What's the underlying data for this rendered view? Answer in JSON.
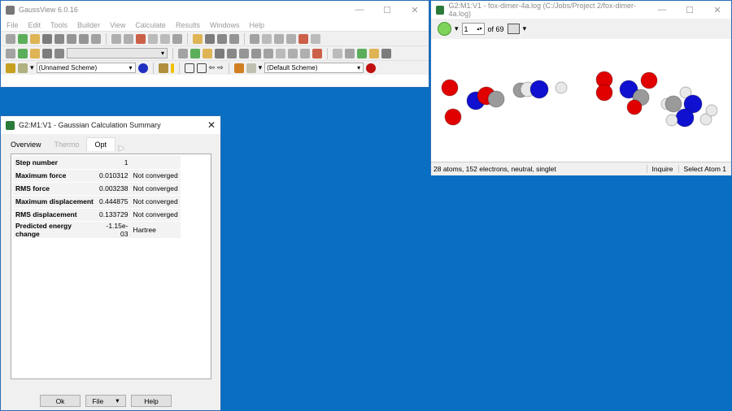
{
  "main_window": {
    "title": "GaussView 6.0.16",
    "menu": [
      "File",
      "Edit",
      "Tools",
      "Builder",
      "View",
      "Calculate",
      "Results",
      "Windows",
      "Help"
    ],
    "toolbar1": [
      "new-icon",
      "add-icon",
      "open-icon",
      "save-icon",
      "print-icon",
      "camera-icon",
      "save-image-icon",
      "list-icon",
      "|",
      "cut-icon",
      "copy-icon",
      "paste-icon",
      "delete-icon",
      "undo-icon",
      "redo-icon",
      "|",
      "symmetry-icon",
      "clean-icon",
      "bond-icon",
      "fragment-icon",
      "|",
      "text-a-icon",
      "r-group-icon",
      "link-icon",
      "layers-icon",
      "diamond-icon",
      "atom-pin-icon"
    ],
    "toolbar2": [
      "builder-a-icon",
      "ring-icon",
      "chain-icon",
      "dots-icon",
      "fragment-b-icon"
    ],
    "toolbar2b": [
      "bond-length-icon",
      "angle-icon",
      "dihedral-icon",
      "inquire-icon",
      "invert-icon",
      "move-icon",
      "lamp-icon",
      "star-icon",
      "search-icon",
      "sprout-icon",
      "dot-icon",
      "sparkle-icon",
      "|",
      "window-add-icon",
      "expand-icon",
      "window-icon",
      "copy-window-icon",
      "sync-icon"
    ],
    "scheme1": "(Unnamed Scheme)",
    "scheme2": "(Default Scheme)"
  },
  "molecule_window": {
    "title": "G2:M1:V1 - fox-dimer-4a.log (C:/Jobs/Project 2/fox-dimer-4a.log)",
    "frame": "1",
    "of_label": "of 69",
    "status": "28 atoms, 152 electrons, neutral, singlet",
    "mode": "Inquire",
    "selection": "Select Atom 1"
  },
  "dialog": {
    "title": "G2:M1:V1 - Gaussian Calculation Summary",
    "tabs": [
      "Overview",
      "Thermo",
      "Opt"
    ],
    "rows": [
      {
        "label": "Step number",
        "value": "1",
        "status": ""
      },
      {
        "label": "Maximum force",
        "value": "0.010312",
        "status": "Not converged"
      },
      {
        "label": "RMS force",
        "value": "0.003238",
        "status": "Not converged"
      },
      {
        "label": "Maximum displacement",
        "value": "0.444875",
        "status": "Not converged"
      },
      {
        "label": "RMS displacement",
        "value": "0.133729",
        "status": "Not converged"
      },
      {
        "label": "Predicted energy change",
        "value": "-1.15e-03",
        "status": "Hartree"
      }
    ],
    "buttons": {
      "ok": "Ok",
      "file": "File",
      "help": "Help"
    }
  },
  "colors": {
    "desktop": "#0a6fc2",
    "oxygen": "#e00000",
    "nitrogen": "#1010d0",
    "carbon": "#9a9a9a",
    "hydrogen": "#e8e8e8"
  }
}
